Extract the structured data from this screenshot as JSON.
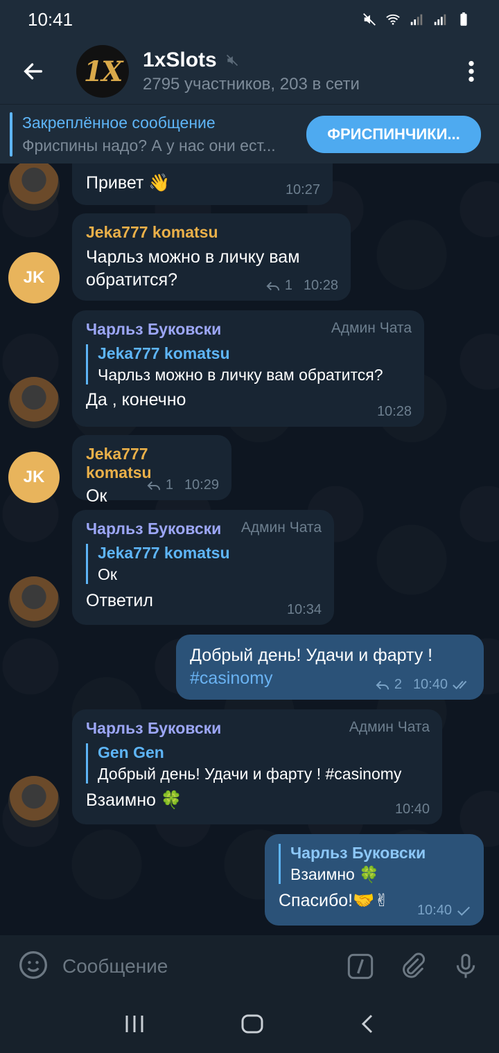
{
  "status": {
    "time": "10:41"
  },
  "header": {
    "avatar_text": "1X",
    "title": "1xSlots",
    "subtitle": "2795 участников, 203 в сети"
  },
  "pinned": {
    "title": "Закреплённое сообщение",
    "body": "Фриспины надо? А у нас они ест...",
    "button": "ФРИСПИНЧИКИ..."
  },
  "messages": [
    {
      "text": "Привет 👋",
      "time": "10:27"
    },
    {
      "sender": "Jeka777 komatsu",
      "avatar": "JK",
      "text": "Чарльз можно в личку вам обратится?",
      "replies": "1",
      "time": "10:28"
    },
    {
      "sender": "Чарльз Буковски",
      "role": "Админ Чата",
      "reply_name": "Jeka777 komatsu",
      "reply_text": "Чарльз можно в личку вам обратится?",
      "text": "Да , конечно",
      "time": "10:28"
    },
    {
      "sender": "Jeka777 komatsu",
      "avatar": "JK",
      "text": "Ок",
      "replies": "1",
      "time": "10:29"
    },
    {
      "sender": "Чарльз Буковски",
      "role": "Админ Чата",
      "reply_name": "Jeka777 komatsu",
      "reply_text": "Ок",
      "text": "Ответил",
      "time": "10:34"
    },
    {
      "text": "Добрый день! Удачи и фарту !",
      "hashtag": "#casinomy",
      "replies": "2",
      "time": "10:40"
    },
    {
      "sender": "Чарльз Буковски",
      "role": "Админ Чата",
      "reply_name": "Gen Gen",
      "reply_text": "Добрый день! Удачи и фарту !  #casinomy",
      "text": "Взаимно 🍀",
      "time": "10:40"
    },
    {
      "reply_name": "Чарльз Буковски",
      "reply_text": "Взаимно 🍀",
      "text": "Спасибо!🤝✌",
      "time": "10:40"
    }
  ],
  "input": {
    "placeholder": "Сообщение"
  }
}
